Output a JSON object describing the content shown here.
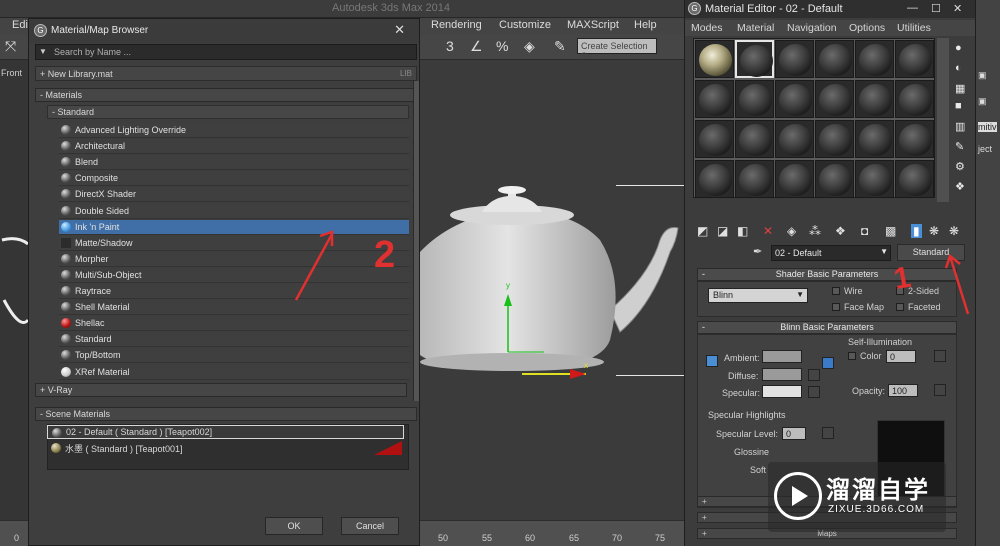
{
  "background": {
    "title_fragment": "Autodesk 3ds Max 2014",
    "menu": [
      "Edit",
      "Rendering",
      "Customize",
      "MAXScript",
      "Help"
    ],
    "create_selection_placeholder": "Create Selection Se",
    "viewport_label": "Front",
    "timeline_ticks": [
      "0",
      "50",
      "55",
      "60",
      "65",
      "70",
      "75"
    ]
  },
  "browser": {
    "title": "Material/Map Browser",
    "search_placeholder": "Search by Name ...",
    "new_library": "+ New Library.mat",
    "lib_tag": "LIB",
    "materials_group": "- Materials",
    "standard_group": "- Standard",
    "items": [
      {
        "label": "Advanced Lighting Override",
        "swatch": "gray"
      },
      {
        "label": "Architectural",
        "swatch": "gray"
      },
      {
        "label": "Blend",
        "swatch": "gray"
      },
      {
        "label": "Composite",
        "swatch": "gray"
      },
      {
        "label": "DirectX Shader",
        "swatch": "gray"
      },
      {
        "label": "Double Sided",
        "swatch": "gray"
      },
      {
        "label": "Ink 'n Paint",
        "swatch": "blue",
        "selected": true
      },
      {
        "label": "Matte/Shadow",
        "swatch": "none"
      },
      {
        "label": "Morpher",
        "swatch": "gray"
      },
      {
        "label": "Multi/Sub-Object",
        "swatch": "gray"
      },
      {
        "label": "Raytrace",
        "swatch": "gray"
      },
      {
        "label": "Shell Material",
        "swatch": "gray"
      },
      {
        "label": "Shellac",
        "swatch": "red"
      },
      {
        "label": "Standard",
        "swatch": "gray"
      },
      {
        "label": "Top/Bottom",
        "swatch": "gray"
      },
      {
        "label": "XRef Material",
        "swatch": "white"
      }
    ],
    "vray_group": "+ V-Ray",
    "scene_group": "- Scene Materials",
    "scene_items": [
      {
        "label": "02 - Default  ( Standard ) [Teapot002]",
        "swatch": "gray"
      },
      {
        "label": "水墨  ( Standard ) [Teapot001]",
        "swatch": "tex"
      }
    ],
    "ok": "OK",
    "cancel": "Cancel"
  },
  "editor": {
    "title": "Material Editor - 02 - Default",
    "menu": [
      "Modes",
      "Material",
      "Navigation",
      "Options",
      "Utilities"
    ],
    "material_name": "02 - Default",
    "type_button": "Standard",
    "shader_rollout": "Shader Basic Parameters",
    "shader": "Blinn",
    "wire": "Wire",
    "two_sided": "2-Sided",
    "face_map": "Face Map",
    "faceted": "Faceted",
    "blinn_rollout": "Blinn Basic Parameters",
    "self_illum": "Self-Illumination",
    "color_label": "Color",
    "color_value": "0",
    "ambient": "Ambient:",
    "diffuse": "Diffuse:",
    "specular": "Specular:",
    "opacity_label": "Opacity:",
    "opacity_value": "100",
    "spec_highlights": "Specular Highlights",
    "spec_level": "Specular Level:",
    "spec_level_value": "0",
    "glossiness": "Glossine",
    "soften": "Soft",
    "maps": "Maps"
  },
  "annotations": [
    "1",
    "2"
  ],
  "watermark": {
    "title": "溜溜自学",
    "subtitle": "ZIXUE.3D66.COM"
  },
  "colors": {
    "selection": "#3f6fa6",
    "annotation": "#e03030"
  }
}
